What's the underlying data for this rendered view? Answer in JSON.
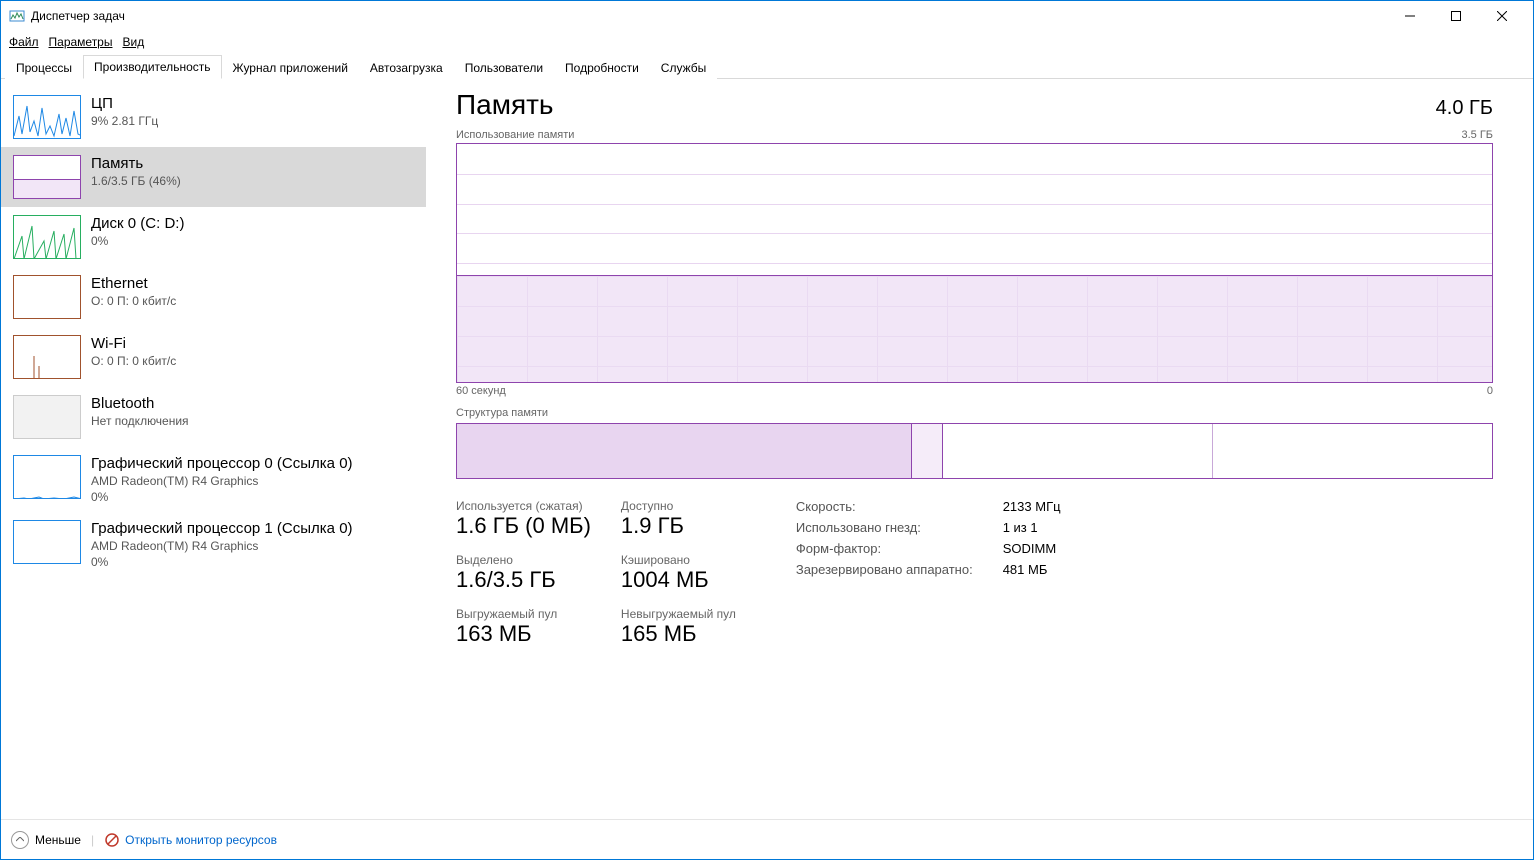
{
  "window": {
    "title": "Диспетчер задач"
  },
  "menu": {
    "file": "Файл",
    "options": "Параметры",
    "view": "Вид"
  },
  "tabs": {
    "processes": "Процессы",
    "performance": "Производительность",
    "app_history": "Журнал приложений",
    "startup": "Автозагрузка",
    "users": "Пользователи",
    "details": "Подробности",
    "services": "Службы"
  },
  "sidebar": {
    "cpu": {
      "title": "ЦП",
      "sub": "9% 2.81 ГГц"
    },
    "memory": {
      "title": "Память",
      "sub": "1.6/3.5 ГБ (46%)"
    },
    "disk": {
      "title": "Диск 0 (C: D:)",
      "sub": "0%"
    },
    "ethernet": {
      "title": "Ethernet",
      "sub": "О: 0 П: 0 кбит/с"
    },
    "wifi": {
      "title": "Wi-Fi",
      "sub": "О: 0 П: 0 кбит/с"
    },
    "bluetooth": {
      "title": "Bluetooth",
      "sub": "Нет подключения"
    },
    "gpu0": {
      "title": "Графический процессор 0 (Ссылка 0)",
      "sub1": "AMD Radeon(TM) R4 Graphics",
      "sub2": "0%"
    },
    "gpu1": {
      "title": "Графический процессор 1 (Ссылка 0)",
      "sub1": "AMD Radeon(TM) R4 Graphics",
      "sub2": "0%"
    }
  },
  "main": {
    "title": "Память",
    "total": "4.0 ГБ",
    "chart_label_left": "Использование памяти",
    "chart_label_right": "3.5 ГБ",
    "chart_axis_left": "60 секунд",
    "chart_axis_right": "0",
    "struct_label": "Структура памяти",
    "stats": {
      "in_use_label": "Используется (сжатая)",
      "in_use_value": "1.6 ГБ (0 МБ)",
      "available_label": "Доступно",
      "available_value": "1.9 ГБ",
      "committed_label": "Выделено",
      "committed_value": "1.6/3.5 ГБ",
      "cached_label": "Кэшировано",
      "cached_value": "1004 МБ",
      "paged_label": "Выгружаемый пул",
      "paged_value": "163 МБ",
      "nonpaged_label": "Невыгружаемый пул",
      "nonpaged_value": "165 МБ"
    },
    "info": {
      "speed_k": "Скорость:",
      "speed_v": "2133 МГц",
      "slots_k": "Использовано гнезд:",
      "slots_v": "1 из 1",
      "form_k": "Форм-фактор:",
      "form_v": "SODIMM",
      "reserved_k": "Зарезервировано аппаратно:",
      "reserved_v": "481 МБ"
    }
  },
  "footer": {
    "fewer": "Меньше",
    "resmon": "Открыть монитор ресурсов"
  },
  "chart_data": {
    "type": "line",
    "title": "Использование памяти",
    "ylabel": "ГБ",
    "ylim": [
      0,
      3.5
    ],
    "xlabel": "секунд",
    "xlim": [
      60,
      0
    ],
    "series": [
      {
        "name": "Память",
        "values": [
          1.6,
          1.6,
          1.6,
          1.6,
          1.6,
          1.6,
          1.6,
          1.6,
          1.6,
          1.6,
          1.6,
          1.6,
          1.6,
          1.6,
          1.6,
          1.6,
          1.6,
          1.6,
          1.6,
          1.6,
          1.6,
          1.6,
          1.6,
          1.6,
          1.6,
          1.6,
          1.6,
          1.6,
          1.6,
          1.6,
          1.6,
          1.6,
          1.6,
          1.6,
          1.6,
          1.6,
          1.6,
          1.6,
          1.6,
          1.6,
          1.6,
          1.6,
          1.6,
          1.6,
          1.6,
          1.6,
          1.6,
          1.6,
          1.6,
          1.6,
          1.6,
          1.6,
          1.6,
          1.6,
          1.6,
          1.6,
          1.6,
          1.6,
          1.6,
          1.6
        ]
      }
    ]
  }
}
